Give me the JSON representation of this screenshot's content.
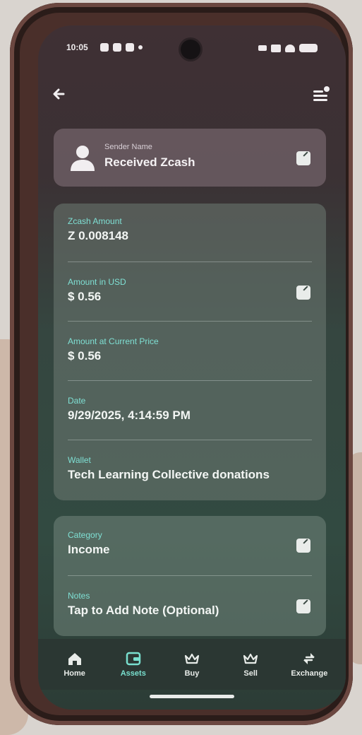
{
  "status_bar": {
    "time": "10:05"
  },
  "sender": {
    "label": "Sender Name",
    "name": "Received Zcash"
  },
  "details": [
    {
      "label": "Zcash Amount",
      "value": "Z 0.008148",
      "editable": false
    },
    {
      "label": "Amount in USD",
      "value": "$ 0.56",
      "editable": true
    },
    {
      "label": "Amount at Current Price",
      "value": "$ 0.56",
      "editable": false
    },
    {
      "label": "Date",
      "value": "9/29/2025, 4:14:59 PM",
      "editable": false
    },
    {
      "label": "Wallet",
      "value": "Tech Learning Collective donations",
      "editable": false
    }
  ],
  "meta": [
    {
      "label": "Category",
      "value": "Income",
      "editable": true
    },
    {
      "label": "Notes",
      "value": "Tap to Add Note (Optional)",
      "editable": true
    }
  ],
  "nav": [
    {
      "label": "Home",
      "icon": "home-icon",
      "active": false
    },
    {
      "label": "Assets",
      "icon": "wallet-icon",
      "active": true
    },
    {
      "label": "Buy",
      "icon": "crown-icon",
      "active": false
    },
    {
      "label": "Sell",
      "icon": "crown-icon",
      "active": false
    },
    {
      "label": "Exchange",
      "icon": "exchange-icon",
      "active": false
    }
  ],
  "colors": {
    "accent": "#79e0cf",
    "label": "#7fe0d4"
  }
}
